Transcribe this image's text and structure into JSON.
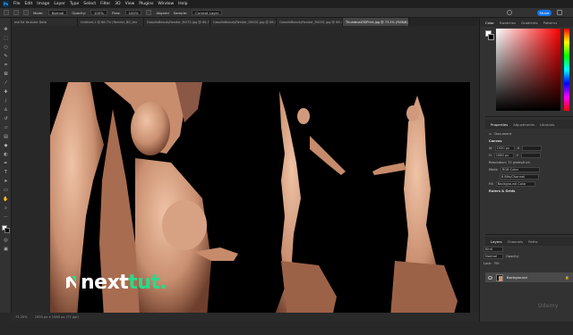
{
  "menubar": {
    "items": [
      "File",
      "Edit",
      "Image",
      "Layer",
      "Type",
      "Select",
      "Filter",
      "3D",
      "View",
      "Plugins",
      "Window",
      "Help"
    ]
  },
  "options": {
    "mode_label": "Mode:",
    "mode_value": "Normal",
    "opacity_label": "Opacity:",
    "opacity_value": "100%",
    "flow_label": "Flow:",
    "flow_value": "100%",
    "aligned_label": "Aligned",
    "sample_label": "Sample:",
    "sample_value": "Current Layer",
    "share_label": "Share"
  },
  "tabs": [
    "eshTut Youtube Data",
    "Untitled-1 @ 66.7% (Render_BG_tex",
    "GasolinBeautyRender_MO72.jpg @ 66.7",
    "GasolinBeautyRender_R0001.jpg @ 66.7",
    "GasolinBeautyRender_R0001.jpg @ 66.7",
    "Thumbnail3DPrint.jpg @ 73.2% (RGB/8)"
  ],
  "canvas": {
    "logo_white": "next",
    "logo_green": "tut."
  },
  "status": {
    "zoom": "73.25%",
    "doc_size": "1920 px x 1080 px (72 ppi)"
  },
  "color_panel": {
    "tabs": [
      "Color",
      "Swatches",
      "Gradients",
      "Patterns"
    ]
  },
  "properties": {
    "tabs": [
      "Properties",
      "Adjustments",
      "Libraries"
    ],
    "type": "Document",
    "section_canvas": "Canvas",
    "w_label": "W",
    "w_value": "1920 px",
    "h_label": "H",
    "h_value": "1080 px",
    "x_label": "X",
    "y_label": "Y",
    "resolution": "Resolution: 72 pixels/inch",
    "mode_label": "Mode",
    "mode_value": "RGB Color",
    "bit_value": "8 Bits/Channel",
    "fill_label": "Fill",
    "fill_value": "Background Color",
    "section_rulers": "Rulers & Grids"
  },
  "layers": {
    "tabs": [
      "Layers",
      "Channels",
      "Paths"
    ],
    "kind": "Kind",
    "blend": "Normal",
    "opacity_label": "Opacity:",
    "lock_label": "Lock:",
    "fill_label": "Fill:",
    "background_layer": "Background"
  },
  "watermark": "Udemy"
}
